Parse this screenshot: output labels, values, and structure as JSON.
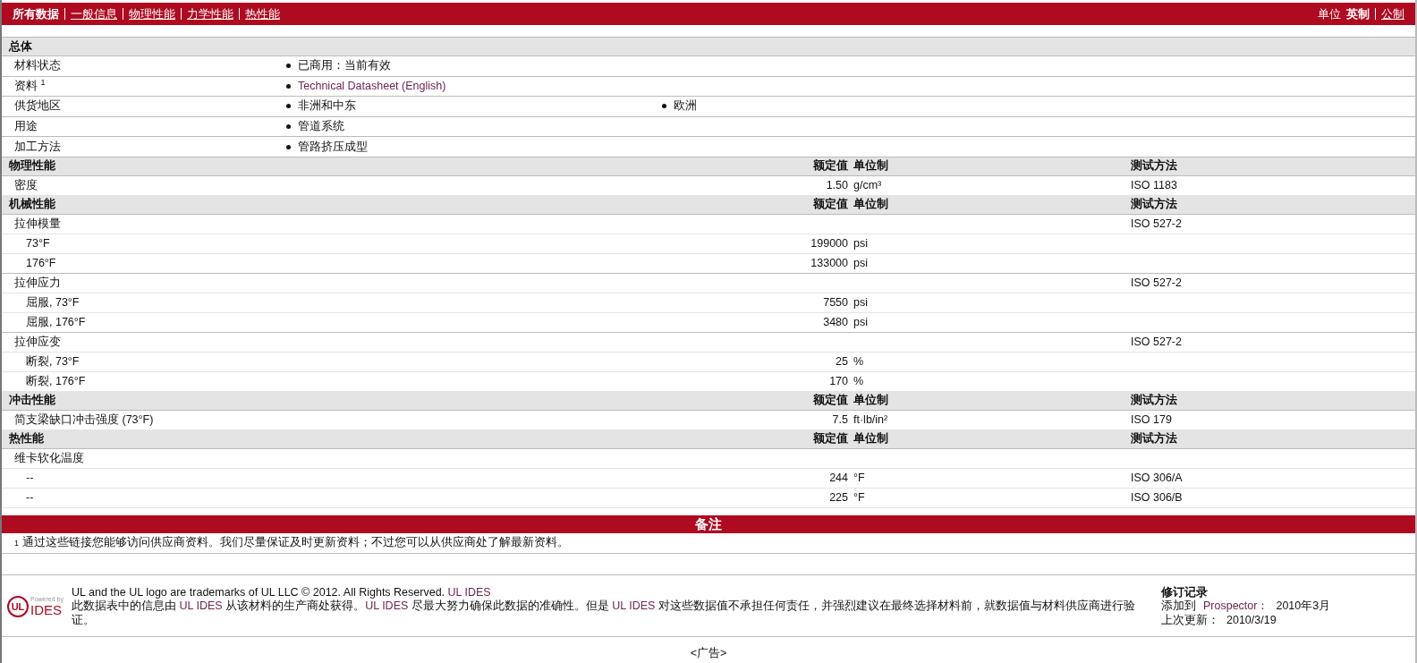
{
  "nav": {
    "tabs": [
      {
        "label": "所有数据",
        "selected": true
      },
      {
        "label": "一般信息",
        "selected": false
      },
      {
        "label": "物理性能",
        "selected": false
      },
      {
        "label": "力学性能",
        "selected": false
      },
      {
        "label": "热性能",
        "selected": false
      }
    ],
    "units_label": "单位",
    "units": [
      {
        "label": "英制",
        "selected": true
      },
      {
        "label": "公制",
        "selected": false
      }
    ]
  },
  "general": {
    "title": "总体",
    "rows": [
      {
        "name": "材料状态",
        "items": [
          {
            "kind": "text",
            "text": "已商用：当前有效"
          }
        ]
      },
      {
        "name": "资料 $^{1}$",
        "items": [
          {
            "kind": "link",
            "text": "Technical Datasheet (English)"
          }
        ]
      },
      {
        "name": "供货地区",
        "items": [
          {
            "kind": "text",
            "text": "非洲和中东"
          },
          {
            "kind": "text",
            "text": "欧洲"
          }
        ]
      },
      {
        "name": "用途",
        "items": [
          {
            "kind": "text",
            "text": "管道系统"
          }
        ]
      },
      {
        "name": "加工方法",
        "items": [
          {
            "kind": "text",
            "text": "管路挤压成型"
          }
        ]
      }
    ]
  },
  "sections": [
    {
      "title": "物理性能",
      "value_header": "额定值",
      "unit_header": "单位制",
      "method_header": "测试方法",
      "rows": [
        {
          "name": "密度",
          "value": "1.50",
          "unit": "g/cm³",
          "method": "ISO 1183"
        }
      ]
    },
    {
      "title": "机械性能",
      "value_header": "额定值",
      "unit_header": "单位制",
      "method_header": "测试方法",
      "rows": [
        {
          "name": "拉伸模量",
          "method": "ISO 527-2",
          "children": [
            {
              "name": "73°F",
              "value": "199000",
              "unit": "psi"
            },
            {
              "name": "176°F",
              "value": "133000",
              "unit": "psi"
            }
          ]
        },
        {
          "name": "拉伸应力",
          "method": "ISO 527-2",
          "children": [
            {
              "name": "屈服, 73°F",
              "value": "7550",
              "unit": "psi"
            },
            {
              "name": "屈服, 176°F",
              "value": "3480",
              "unit": "psi"
            }
          ]
        },
        {
          "name": "拉伸应变",
          "method": "ISO 527-2",
          "children": [
            {
              "name": "断裂, 73°F",
              "value": "25",
              "unit": "%"
            },
            {
              "name": "断裂, 176°F",
              "value": "170",
              "unit": "%"
            }
          ]
        }
      ]
    },
    {
      "title": "冲击性能",
      "value_header": "额定值",
      "unit_header": "单位制",
      "method_header": "测试方法",
      "rows": [
        {
          "name": "简支梁缺口冲击强度 (73°F)",
          "value": "7.5",
          "unit": "ft·lb/in²",
          "method": "ISO 179"
        }
      ]
    },
    {
      "title": "热性能",
      "value_header": "额定值",
      "unit_header": "单位制",
      "method_header": "测试方法",
      "rows": [
        {
          "name": "维卡软化温度",
          "children": [
            {
              "name": "--",
              "value": "244",
              "unit": "°F",
              "method": "ISO 306/A"
            },
            {
              "name": "--",
              "value": "225",
              "unit": "°F",
              "method": "ISO 306/B"
            }
          ]
        }
      ]
    }
  ],
  "notes": {
    "title": "备注",
    "items": [
      {
        "mark": "1",
        "text": "通过这些链接您能够访问供应商资料。我们尽量保证及时更新资料；不过您可以从供应商处了解最新资料。"
      }
    ]
  },
  "footer": {
    "logo": {
      "mark": "UL",
      "powered": "Powered by",
      "name": "IDES"
    },
    "trademark": [
      {
        "kind": "text",
        "text": "UL and the UL logo are trademarks of UL LLC © 2012. All Rights Reserved. "
      },
      {
        "kind": "link",
        "text": "UL IDES"
      }
    ],
    "disclaimer": [
      {
        "kind": "text",
        "text": "此数据表中的信息由 "
      },
      {
        "kind": "link",
        "text": "UL IDES"
      },
      {
        "kind": "text",
        "text": " 从该材料的生产商处获得。"
      },
      {
        "kind": "link",
        "text": "UL IDES"
      },
      {
        "kind": "text",
        "text": " 尽最大努力确保此数据的准确性。但是 "
      },
      {
        "kind": "link",
        "text": "UL IDES"
      },
      {
        "kind": "text",
        "text": " 对这些数据值不承担任何责任，并强烈建议在最终选择材料前，就数据值与材料供应商进行验证。"
      }
    ],
    "revision": {
      "title": "修订记录",
      "rows": [
        {
          "label": "添加到",
          "link": "Prospector：",
          "value": "2010年3月"
        },
        {
          "label": "上次更新：",
          "value": "2010/3/19"
        }
      ]
    }
  },
  "ad": "<广告>"
}
